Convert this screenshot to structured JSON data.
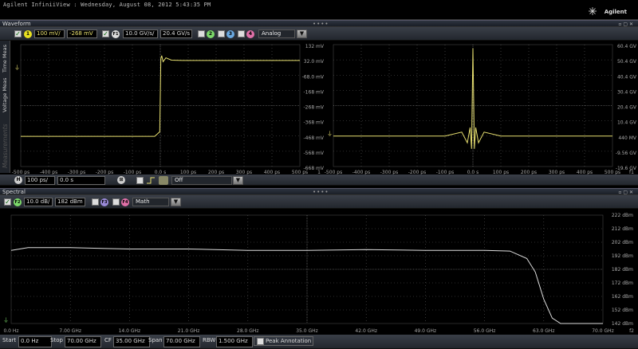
{
  "app": {
    "title": "Agilent InfiniiView : Wednesday, August 08, 2012 5:43:35 PM",
    "brand": "Agilent"
  },
  "waveform_pane": {
    "header": "Waveform",
    "side_tabs": [
      "Time Meas",
      "Voltage Meas",
      "Measurements"
    ],
    "channel1": {
      "badge": "1",
      "scale": "100 mV/",
      "offset": "-268 mV"
    },
    "f1": {
      "badge": "F1",
      "scale": "10.0 GV/s/",
      "offset": "20.4 GV/s"
    },
    "channels": [
      "2",
      "3",
      "4"
    ],
    "mode_select": "Analog",
    "horizontal": {
      "badge": "H",
      "scale": "100 ps/",
      "position": "0.0 s"
    },
    "trigger_select": "Off",
    "left_y_ticks": [
      "132 mV",
      "32.0 mV",
      "-68.0 mV",
      "-168 mV",
      "-268 mV",
      "-368 mV",
      "-468 mV",
      "-568 mV",
      "-668 mV"
    ],
    "right_y_ticks": [
      "60.4 GV",
      "50.4 GV",
      "40.4 GV",
      "30.4 GV",
      "20.4 GV",
      "10.4 GV",
      "440 MV",
      "-9.56 GV",
      "-19.6 GV"
    ],
    "x_ticks": [
      "-500 ps",
      "-400 ps",
      "-300 ps",
      "-200 ps",
      "-100 ps",
      "0.0 s",
      "100 ps",
      "200 ps",
      "300 ps",
      "400 ps",
      "500 ps"
    ],
    "x_channel_left": "1",
    "x_channel_right": "f1"
  },
  "spectral_pane": {
    "header": "Spectral",
    "f2": {
      "badge": "F2",
      "scale": "10.0 dB/",
      "offset": "182 dBm"
    },
    "functions": [
      "F3",
      "F4"
    ],
    "math_select": "Math",
    "y_ticks": [
      "222 dBm",
      "212 dBm",
      "202 dBm",
      "192 dBm",
      "182 dBm",
      "172 dBm",
      "162 dBm",
      "152 dBm",
      "142 dBm"
    ],
    "x_ticks": [
      "0.0 Hz",
      "7.00 GHz",
      "14.0 GHz",
      "21.0 GHz",
      "28.0 GHz",
      "35.0 GHz",
      "42.0 GHz",
      "49.0 GHz",
      "56.0 GHz",
      "63.0 GHz",
      "70.0 GHz"
    ],
    "x_channel": "f2"
  },
  "bottom_bar": {
    "start_label": "Start",
    "start_value": "0.0 Hz",
    "stop_label": "Stop",
    "stop_value": "70.00 GHz",
    "cf_label": "CF",
    "cf_value": "35.00 GHz",
    "span_label": "Span",
    "span_value": "70.00 GHz",
    "rbw_label": "RBW",
    "rbw_value": "1.500 GHz",
    "peak_annotation": "Peak Annotation"
  },
  "colors": {
    "trace": "#e8e070",
    "grid": "#5a5a5a",
    "ch1": "#e8e020",
    "ch2": "#7cd96a",
    "ch3": "#6aa8e0",
    "ch4": "#e070a8"
  },
  "chart_data": [
    {
      "type": "line",
      "title": "",
      "ylabel": "",
      "xlabel": "",
      "x_unit": "ps",
      "y_unit": "mV",
      "ylim": [
        -668,
        132
      ],
      "xlim": [
        -500,
        500
      ],
      "series": [
        {
          "x": [
            -500,
            -20,
            -2,
            0,
            2,
            5,
            10,
            20,
            40,
            80,
            500
          ],
          "y": [
            -470,
            -470,
            -440,
            -200,
            40,
            60,
            20,
            45,
            30,
            28,
            28
          ]
        }
      ]
    },
    {
      "type": "line",
      "title": "",
      "x_unit": "ps",
      "y_unit": "GV/s",
      "ylim": [
        -19.6,
        60.4
      ],
      "xlim": [
        -500,
        500
      ],
      "series": [
        {
          "x": [
            -500,
            -100,
            -40,
            -20,
            -10,
            -5,
            0,
            5,
            10,
            20,
            40,
            100,
            500
          ],
          "y": [
            0.44,
            0.44,
            3,
            -4,
            6,
            -8,
            58,
            -8,
            6,
            -4,
            3,
            0.44,
            0.44
          ]
        }
      ]
    },
    {
      "type": "line",
      "title": "",
      "x_unit": "GHz",
      "y_unit": "dBm",
      "ylim": [
        142,
        222
      ],
      "xlim": [
        0,
        70
      ],
      "series": [
        {
          "x": [
            0,
            2,
            7,
            14,
            21,
            28,
            35,
            42,
            49,
            56,
            59,
            61,
            62,
            63,
            64,
            65,
            70
          ],
          "y": [
            196,
            198,
            198,
            197,
            197,
            196,
            196,
            196.5,
            196,
            196,
            195.5,
            190,
            180,
            160,
            146,
            142,
            142
          ]
        }
      ]
    }
  ]
}
